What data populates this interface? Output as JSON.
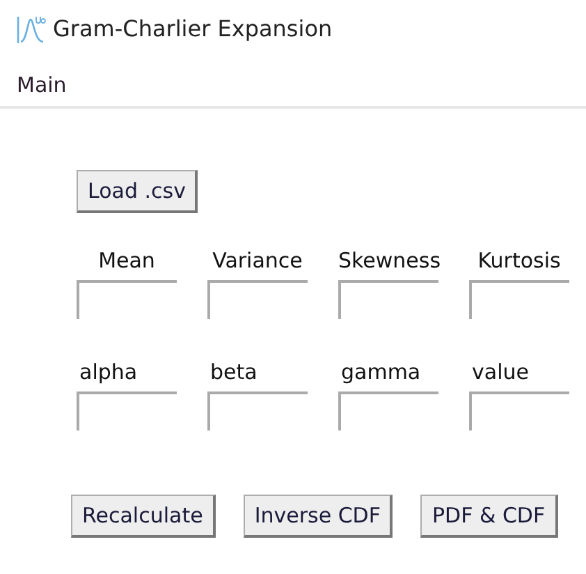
{
  "window": {
    "title": "Gram-Charlier Expansion"
  },
  "menu": [
    "Main"
  ],
  "load_button": "Load .csv",
  "moment_fields": [
    {
      "label": "Mean"
    },
    {
      "label": "Variance"
    },
    {
      "label": "Skewness"
    },
    {
      "label": "Kurtosis"
    }
  ],
  "parameter_fields": [
    {
      "label": "alpha"
    },
    {
      "label": "beta"
    },
    {
      "label": "gamma"
    },
    {
      "label": "value"
    }
  ],
  "buttons": [
    "Recalculate",
    "Inverse CDF",
    "PDF & CDF"
  ]
}
